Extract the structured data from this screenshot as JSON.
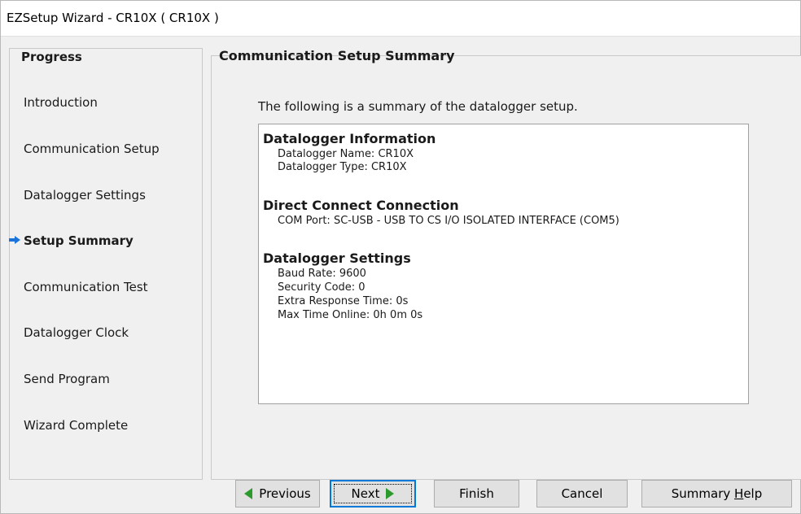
{
  "window": {
    "title": "EZSetup Wizard - CR10X ( CR10X )"
  },
  "progress": {
    "heading": "Progress",
    "steps": [
      {
        "label": "Introduction",
        "current": false
      },
      {
        "label": "Communication Setup",
        "current": false
      },
      {
        "label": "Datalogger Settings",
        "current": false
      },
      {
        "label": "Setup Summary",
        "current": true
      },
      {
        "label": "Communication Test",
        "current": false
      },
      {
        "label": "Datalogger Clock",
        "current": false
      },
      {
        "label": "Send Program",
        "current": false
      },
      {
        "label": "Wizard Complete",
        "current": false
      }
    ],
    "current_marker_icon": "right-arrow-icon"
  },
  "main": {
    "heading": "Communication Setup Summary",
    "intro": "The following is a summary of the datalogger setup.",
    "sections": [
      {
        "title": "Datalogger Information",
        "lines": [
          "Datalogger Name: CR10X",
          "Datalogger Type: CR10X"
        ]
      },
      {
        "title": "Direct Connect Connection",
        "lines": [
          "COM Port: SC-USB - USB TO CS I/O ISOLATED INTERFACE (COM5)"
        ]
      },
      {
        "title": "Datalogger Settings",
        "lines": [
          "Baud Rate: 9600",
          "Security Code: 0",
          "Extra Response Time: 0s",
          "Max Time Online: 0h 0m 0s"
        ]
      }
    ]
  },
  "buttons": {
    "previous": "Previous",
    "next": "Next",
    "finish": "Finish",
    "cancel": "Cancel",
    "help_prefix": "Summary ",
    "help_mnemonic": "H",
    "help_suffix": "elp"
  },
  "colors": {
    "arrow": "#2c9a2c",
    "current_marker": "#1a73d9",
    "focus": "#0078d7"
  }
}
